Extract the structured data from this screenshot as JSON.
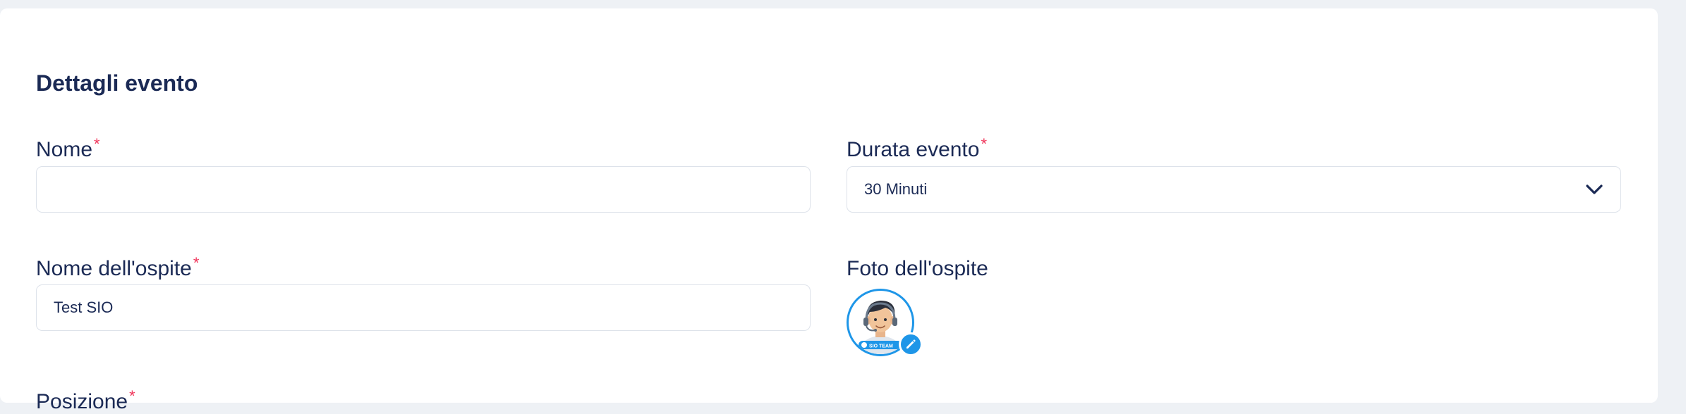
{
  "section": {
    "title": "Dettagli evento"
  },
  "fields": {
    "name": {
      "label": "Nome",
      "required_mark": "*",
      "value": ""
    },
    "duration": {
      "label": "Durata evento",
      "required_mark": "*",
      "selected": "30 Minuti"
    },
    "host_name": {
      "label": "Nome dell'ospite",
      "required_mark": "*",
      "value": "Test SIO"
    },
    "host_photo": {
      "label": "Foto dell'ospite",
      "badge_text": "SIO TEAM"
    }
  },
  "next_field": {
    "label": "Posizione",
    "required_mark": "*"
  },
  "colors": {
    "accent": "#1e96e8",
    "text": "#1b2a55",
    "required": "#f0355a",
    "border": "#dde2ea"
  },
  "icons": {
    "duration_select": "chevron-down-icon",
    "photo_edit": "pencil-icon"
  }
}
